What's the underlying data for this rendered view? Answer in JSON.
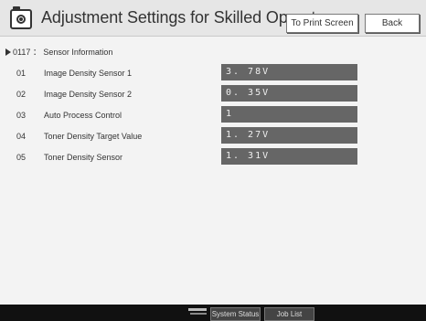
{
  "header": {
    "title": "Adjustment Settings for Skilled Operators",
    "print_label": "To Print Screen",
    "back_label": "Back"
  },
  "section": {
    "label": "0117 ： Sensor Information"
  },
  "rows": [
    {
      "num": "01",
      "label": "Image Density Sensor 1",
      "value": "3. 78V"
    },
    {
      "num": "02",
      "label": "Image Density Sensor 2",
      "value": "0. 35V"
    },
    {
      "num": "03",
      "label": "Auto Process Control",
      "value": "1"
    },
    {
      "num": "04",
      "label": "Toner Density Target Value",
      "value": "1. 27V"
    },
    {
      "num": "05",
      "label": "Toner Density Sensor",
      "value": "1. 31V"
    }
  ],
  "bottom_bar": {
    "system_status_label": "System Status",
    "job_list_label": "Job List"
  },
  "colors": {
    "value_field": "#666666",
    "bottom_bar": "#111111"
  },
  "icons": {
    "app": "camera-icon",
    "status": "status-indicator-icon"
  }
}
